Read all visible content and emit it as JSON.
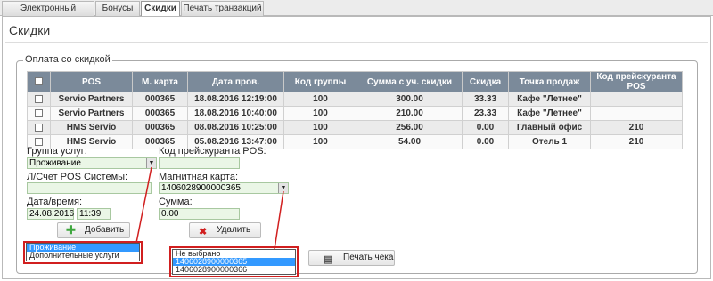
{
  "tabs": [
    {
      "label": "Электронный кошелёк"
    },
    {
      "label": "Бонусы"
    },
    {
      "label": "Скидки"
    },
    {
      "label": "Печать транзакций"
    }
  ],
  "page": {
    "title": "Скидки"
  },
  "section": {
    "legend": "Оплата со скидкой"
  },
  "table": {
    "columns": [
      "POS",
      "М. карта",
      "Дата пров.",
      "Код группы",
      "Сумма с уч. скидки",
      "Скидка",
      "Точка продаж",
      "Код прейскуранта POS"
    ],
    "rows": [
      [
        "Servio Partners",
        "000365",
        "18.08.2016 12:19:00",
        "100",
        "300.00",
        "33.33",
        "Кафе \"Летнее\"",
        ""
      ],
      [
        "Servio Partners",
        "000365",
        "18.08.2016 10:40:00",
        "100",
        "210.00",
        "23.33",
        "Кафе \"Летнее\"",
        ""
      ],
      [
        "HMS Servio",
        "000365",
        "08.08.2016 10:25:00",
        "100",
        "256.00",
        "0.00",
        "Главный офис",
        "210"
      ],
      [
        "HMS Servio",
        "000365",
        "05.08.2016 13:47:00",
        "100",
        "54.00",
        "0.00",
        "Отель 1",
        "210"
      ]
    ]
  },
  "form": {
    "service_group_label": "Группа услуг:",
    "service_group_value": "Проживание",
    "price_code_label": "Код прейскуранта POS:",
    "price_code_value": "",
    "account_label": "Л/Счет POS Системы:",
    "account_value": "",
    "mag_card_label": "Магнитная карта:",
    "mag_card_value": "1406028900000365",
    "datetime_label": "Дата/время:",
    "date_value": "24.08.2016",
    "time_value": "11:39",
    "sum_label": "Сумма:",
    "sum_value": "0.00"
  },
  "buttons": {
    "add": "Добавить",
    "delete": "Удалить",
    "print": "Печать чека"
  },
  "service_group_dropdown": {
    "options": [
      "Проживание",
      "Дополнительные услуги"
    ],
    "selected": "Проживание"
  },
  "mag_card_dropdown": {
    "options": [
      "Не выбрано",
      "1406028900000365",
      "1406028900000366"
    ],
    "selected": "1406028900000365"
  },
  "colors": {
    "accent": "#3399ff",
    "header": "#7b8a9a",
    "callout": "#d11f1f",
    "input_bg": "#eaf6e6",
    "add_icon": "#3ea63e",
    "delete_icon": "#d11f1f"
  }
}
